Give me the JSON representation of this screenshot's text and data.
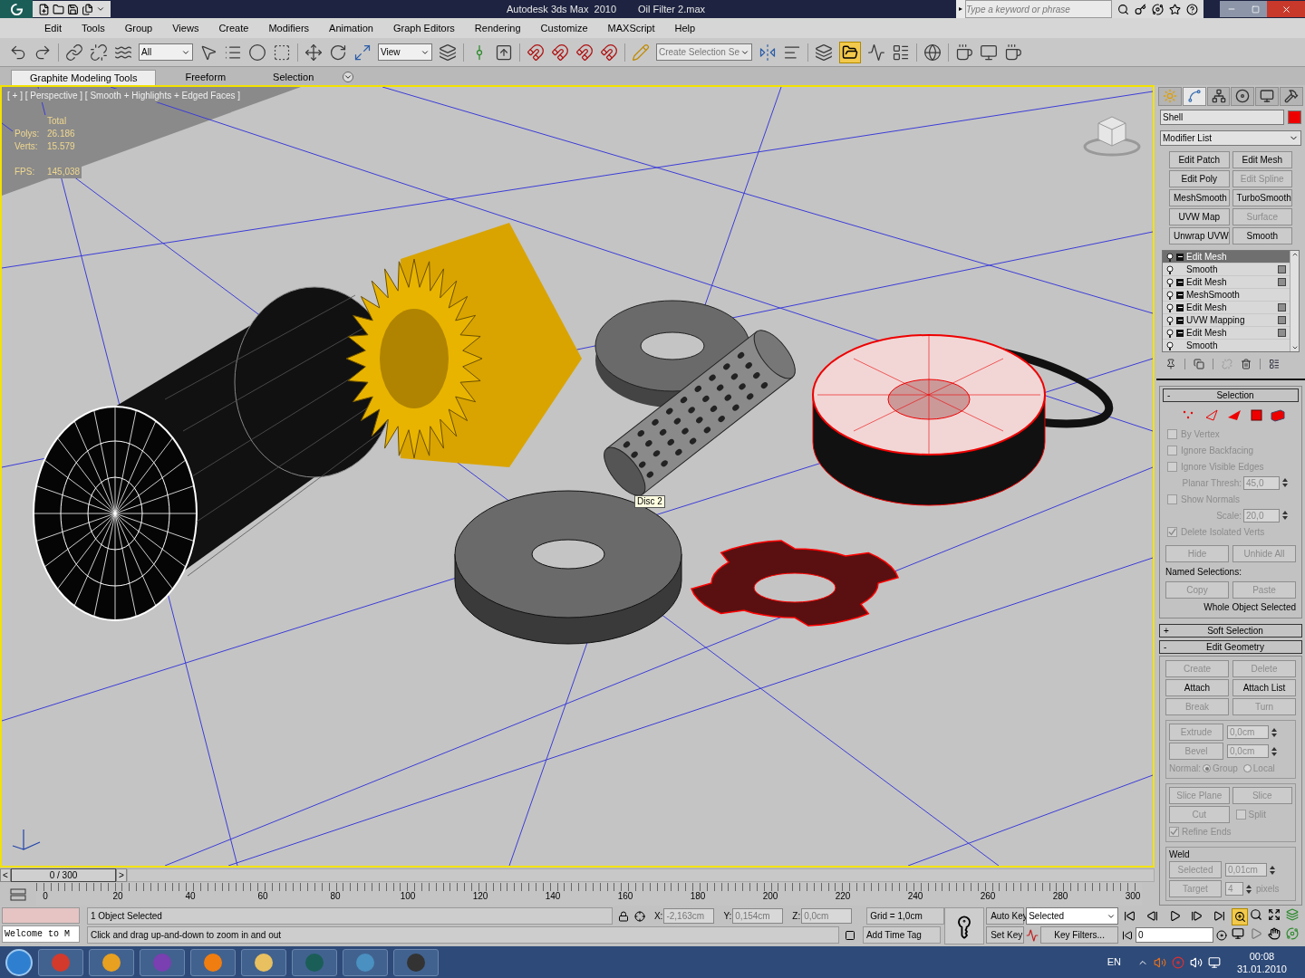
{
  "title_bar": {
    "app_title": "Autodesk 3ds Max  2010",
    "file_name": "Oil Filter 2.max",
    "search_placeholder": "Type a keyword or phrase",
    "search_arrow": "▸"
  },
  "menu": [
    "Edit",
    "Tools",
    "Group",
    "Views",
    "Create",
    "Modifiers",
    "Animation",
    "Graph Editors",
    "Rendering",
    "Customize",
    "MAXScript",
    "Help"
  ],
  "toolbar": {
    "selection_filter": "All",
    "reference_coordinate": "View",
    "named_selection_placeholder": "Create Selection Se"
  },
  "ribbon_tabs": [
    {
      "label": "Graphite Modeling Tools",
      "selected": true
    },
    {
      "label": "Freeform",
      "selected": false
    },
    {
      "label": "Selection",
      "selected": false
    }
  ],
  "viewport": {
    "label": "[ + ] [ Perspective ] [ Smooth + Highlights + Edged Faces ]",
    "stats_header": "Total",
    "stats": [
      {
        "label": "Polys:",
        "value": "26.186"
      },
      {
        "label": "Verts:",
        "value": "15.579"
      }
    ],
    "fps_label": "FPS:",
    "fps_value": "145,038",
    "tooltip": "Disc 2"
  },
  "command_panel": {
    "tabs": [
      {
        "kind": "create",
        "selected": false
      },
      {
        "kind": "modify",
        "selected": true
      },
      {
        "kind": "hierarchy",
        "selected": false
      },
      {
        "kind": "motion",
        "selected": false
      },
      {
        "kind": "display",
        "selected": false
      },
      {
        "kind": "utilities",
        "selected": false
      }
    ],
    "object_name": "Shell",
    "modifier_list": "Modifier List",
    "modifier_buttons": [
      {
        "label": "Edit Patch",
        "disabled": false
      },
      {
        "label": "Edit Mesh",
        "disabled": false
      },
      {
        "label": "Edit Poly",
        "disabled": false
      },
      {
        "label": "Edit Spline",
        "disabled": true
      },
      {
        "label": "MeshSmooth",
        "disabled": false
      },
      {
        "label": "TurboSmooth",
        "disabled": false
      },
      {
        "label": "UVW Map",
        "disabled": false
      },
      {
        "label": "Surface",
        "disabled": true
      },
      {
        "label": "Unwrap UVW",
        "disabled": false
      },
      {
        "label": "Smooth",
        "disabled": false
      }
    ],
    "stack": [
      {
        "label": "Edit Mesh",
        "selected": true,
        "expandable": true,
        "toggle": false
      },
      {
        "label": "Smooth",
        "selected": false,
        "expandable": false,
        "toggle": true
      },
      {
        "label": "Edit Mesh",
        "selected": false,
        "expandable": true,
        "toggle": true
      },
      {
        "label": "MeshSmooth",
        "selected": false,
        "expandable": true,
        "toggle": false
      },
      {
        "label": "Edit Mesh",
        "selected": false,
        "expandable": true,
        "toggle": true
      },
      {
        "label": "UVW Mapping",
        "selected": false,
        "expandable": true,
        "toggle": true
      },
      {
        "label": "Edit Mesh",
        "selected": false,
        "expandable": true,
        "toggle": true
      },
      {
        "label": "Smooth",
        "selected": false,
        "expandable": false,
        "toggle": false
      }
    ]
  },
  "selection_rollout": {
    "sign": "-",
    "title": "Selection",
    "items": [
      {
        "kind": "checkbox",
        "label": "By Vertex",
        "checked": false
      },
      {
        "kind": "checkbox",
        "label": "Ignore Backfacing",
        "checked": false
      },
      {
        "kind": "checkbox",
        "label": "Ignore Visible Edges",
        "checked": false
      },
      {
        "kind": "spinner",
        "label": "Planar Thresh:",
        "value": "45,0"
      },
      {
        "kind": "checkbox",
        "label": "Show Normals",
        "checked": false
      },
      {
        "kind": "spinner",
        "label": "Scale:",
        "value": "20,0"
      },
      {
        "kind": "checkbox",
        "label": "Delete Isolated Verts",
        "checked": true
      }
    ],
    "hide_buttons": [
      {
        "label": "Hide",
        "disabled": true
      },
      {
        "label": "Unhide All",
        "disabled": true
      }
    ],
    "named_selections_label": "Named Selections:",
    "named_buttons": [
      {
        "label": "Copy",
        "disabled": true
      },
      {
        "label": "Paste",
        "disabled": true
      }
    ],
    "status": "Whole Object Selected"
  },
  "soft_selection_rollout": {
    "sign": "+",
    "title": "Soft Selection"
  },
  "edit_geometry_rollout": {
    "sign": "-",
    "title": "Edit Geometry",
    "button_rows": [
      [
        {
          "label": "Create",
          "disabled": true
        },
        {
          "label": "Delete",
          "disabled": true
        }
      ],
      [
        {
          "label": "Attach",
          "disabled": false
        },
        {
          "label": "Attach List",
          "disabled": false
        }
      ],
      [
        {
          "label": "Break",
          "disabled": true
        },
        {
          "label": "Turn",
          "disabled": true
        }
      ]
    ],
    "spinners": [
      {
        "label": "Extrude",
        "value": "0,0cm"
      },
      {
        "label": "Bevel",
        "value": "0,0cm"
      }
    ],
    "normal_label": "Normal:",
    "normal_options": [
      {
        "label": "Group",
        "selected": true
      },
      {
        "label": "Local",
        "selected": false
      }
    ],
    "slice_plane": "Slice Plane",
    "slice": "Slice",
    "cut": "Cut",
    "split": {
      "label": "Split",
      "checked": false
    },
    "refine_ends": {
      "label": "Refine Ends",
      "checked": true
    },
    "weld": {
      "title": "Weld",
      "selected_button": "Selected",
      "selected_value": "0,01cm",
      "target_button": "Target",
      "target_value": "4",
      "target_unit": "pixels"
    }
  },
  "timeline": {
    "prev": "<",
    "position": "0 / 300",
    "next": ">",
    "ticks": [
      "0",
      "20",
      "40",
      "60",
      "80",
      "100",
      "120",
      "140",
      "160",
      "180",
      "200",
      "220",
      "240",
      "260",
      "280",
      "300"
    ]
  },
  "status_bar": {
    "listener_output": "Welcome to M",
    "selection_info": "1 Object Selected",
    "prompt": "Click and drag up-and-down to zoom in and out",
    "coords": [
      {
        "label": "X:",
        "value": "-2,163cm"
      },
      {
        "label": "Y:",
        "value": "0,154cm"
      },
      {
        "label": "Z:",
        "value": "0,0cm"
      }
    ],
    "grid": "Grid = 1,0cm",
    "add_time_tag": "Add Time Tag",
    "auto_key": "Auto Key",
    "set_key": "Set Key",
    "key_mode": "Selected",
    "key_filters": "Key Filters...",
    "frame": "0"
  },
  "taskbar": {
    "language": "EN",
    "time": "00:08",
    "date": "31.01.2010"
  }
}
